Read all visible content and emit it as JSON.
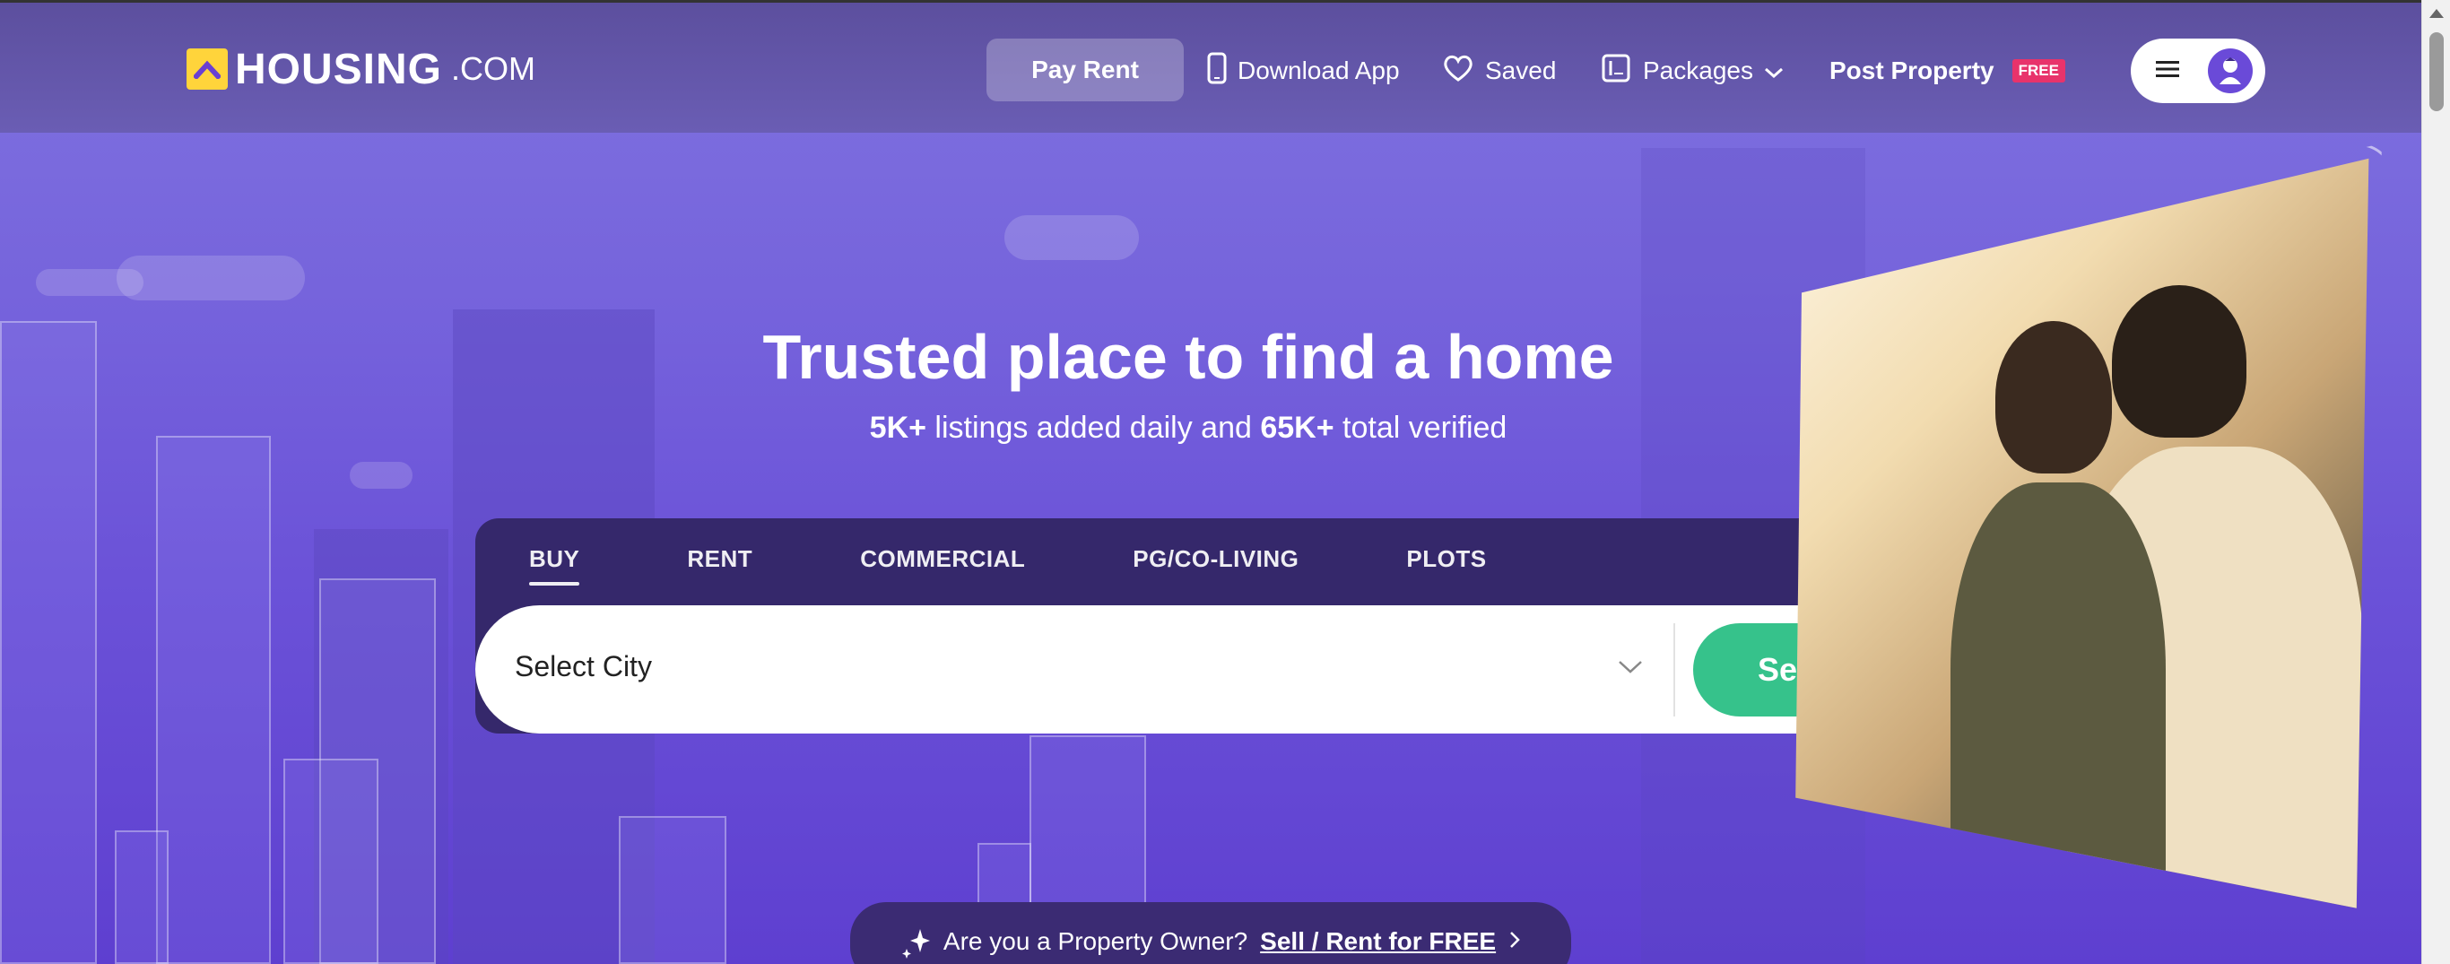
{
  "header": {
    "logo_text": "HOUSING",
    "logo_suffix": ".COM",
    "pay_rent": "Pay Rent",
    "download_app": "Download App",
    "saved": "Saved",
    "packages": "Packages",
    "post_property": "Post Property",
    "free_badge": "FREE"
  },
  "hero": {
    "title": "Trusted place to find a home",
    "sub_count1": "5K+",
    "sub_text1": " listings added daily and ",
    "sub_count2": "65K+",
    "sub_text2": " total verified"
  },
  "search": {
    "tabs": [
      "BUY",
      "RENT",
      "COMMERCIAL",
      "PG/CO-LIVING",
      "PLOTS"
    ],
    "active_tab": "BUY",
    "city_placeholder": "Select City",
    "search_button": "Search"
  },
  "owner_banner": {
    "question": "Are you a Property Owner?",
    "link": "Sell / Rent for FREE"
  },
  "colors": {
    "accent_green": "#36c28b",
    "brand_yellow": "#ffd43b",
    "free_badge": "#e8336b",
    "hero_purple": "#7664dc"
  },
  "icons": [
    "phone-icon",
    "heart-icon",
    "package-icon",
    "chevron-down-icon",
    "hamburger-icon",
    "avatar-icon",
    "sparkle-icon"
  ]
}
